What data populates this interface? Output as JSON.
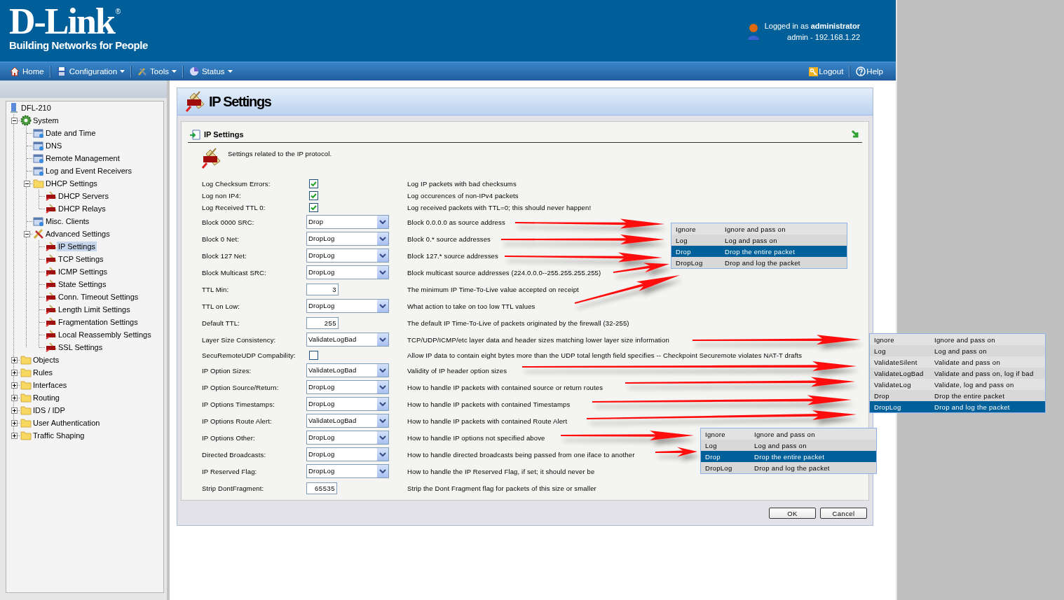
{
  "header": {
    "logo": "D-Link",
    "registered_mark": "®",
    "tagline": "Building Networks for People",
    "login_text": "Logged in as **administrator**",
    "session": "admin - 192.168.1.22"
  },
  "nav": {
    "items": [
      {
        "label": "Home",
        "has_menu": false
      },
      {
        "label": "Configuration",
        "has_menu": true
      },
      {
        "label": "Tools",
        "has_menu": true
      },
      {
        "label": "Status",
        "has_menu": true
      }
    ],
    "right_items": [
      {
        "label": "Logout"
      },
      {
        "label": "Help"
      }
    ]
  },
  "sidebar": {
    "tree": [
      {
        "label": "DFL-210",
        "selected": false,
        "children": [
          {
            "label": "System",
            "selected": false,
            "expanded": true,
            "children": [
              {
                "label": "Date and Time",
                "selected": false
              },
              {
                "label": "DNS",
                "selected": false
              },
              {
                "label": "Remote Management",
                "selected": false
              },
              {
                "label": "Log and Event Receivers",
                "selected": false
              },
              {
                "label": "DHCP Settings",
                "selected": false,
                "expanded": true,
                "children": [
                  {
                    "label": "DHCP Servers",
                    "selected": false
                  },
                  {
                    "label": "DHCP Relays",
                    "selected": false
                  }
                ]
              },
              {
                "label": "Misc. Clients",
                "selected": false
              },
              {
                "label": "Advanced Settings",
                "selected": false,
                "expanded": true,
                "children": [
                  {
                    "label": "IP Settings",
                    "selected": true
                  },
                  {
                    "label": "TCP Settings",
                    "selected": false
                  },
                  {
                    "label": "ICMP Settings",
                    "selected": false
                  },
                  {
                    "label": "State Settings",
                    "selected": false
                  },
                  {
                    "label": "Conn. Timeout Settings",
                    "selected": false
                  },
                  {
                    "label": "Length Limit Settings",
                    "selected": false
                  },
                  {
                    "label": "Fragmentation Settings",
                    "selected": false
                  },
                  {
                    "label": "Local Reassembly Settings",
                    "selected": false
                  },
                  {
                    "label": "SSL Settings",
                    "selected": false
                  }
                ]
              }
            ]
          },
          {
            "label": "Objects",
            "selected": false,
            "expanded": false
          },
          {
            "label": "Rules",
            "selected": false,
            "expanded": false
          },
          {
            "label": "Interfaces",
            "selected": false,
            "expanded": false
          },
          {
            "label": "Routing",
            "selected": false,
            "expanded": false
          },
          {
            "label": "IDS / IDP",
            "selected": false,
            "expanded": false
          },
          {
            "label": "User Authentication",
            "selected": false,
            "expanded": false
          },
          {
            "label": "Traffic Shaping",
            "selected": false,
            "expanded": false
          }
        ]
      }
    ]
  },
  "panel": {
    "title": "IP Settings",
    "section_title": "IP Settings",
    "intro": "Settings related to the IP protocol.",
    "settings": [
      {
        "label": "Log Checksum Errors:",
        "kind": "checkbox",
        "checked": true,
        "description": "Log IP packets with bad checksums"
      },
      {
        "label": "Log non IP4:",
        "kind": "checkbox",
        "checked": true,
        "description": "Log occurences of non-IPv4 packets"
      },
      {
        "label": "Log Received TTL 0:",
        "kind": "checkbox",
        "checked": true,
        "description": "Log received packets with TTL=0; this should never happen!"
      },
      {
        "label": "Block 0000 SRC:",
        "kind": "select",
        "value": "Drop",
        "description": "Block 0.0.0.0 as source address"
      },
      {
        "label": "Block 0 Net:",
        "kind": "select",
        "value": "DropLog",
        "description": "Block 0.* source addresses"
      },
      {
        "label": "Block 127 Net:",
        "kind": "select",
        "value": "DropLog",
        "description": "Block 127.* source addresses"
      },
      {
        "label": "Block Multicast SRC:",
        "kind": "select",
        "value": "DropLog",
        "description": "Block multicast source addresses (224.0.0.0--255.255.255.255)"
      },
      {
        "label": "TTL Min:",
        "kind": "number",
        "value": "3",
        "description": "The minimum IP Time-To-Live value accepted on receipt"
      },
      {
        "label": "TTL on Low:",
        "kind": "select",
        "value": "DropLog",
        "description": "What action to take on too low TTL values"
      },
      {
        "label": "Default TTL:",
        "kind": "number",
        "value": "255",
        "description": "The default IP Time-To-Live of packets originated by the firewall (32-255)"
      },
      {
        "label": "Layer Size Consistency:",
        "kind": "select",
        "value": "ValidateLogBad",
        "description": "TCP/UDP/ICMP/etc layer data and header sizes matching lower layer size information"
      },
      {
        "label": "SecuRemoteUDP Compability:",
        "kind": "checkbox",
        "checked": false,
        "description": "Allow IP data to contain eight bytes more than the UDP total length field specifies -- Checkpoint Securemote violates NAT-T drafts"
      },
      {
        "label": "IP Option Sizes:",
        "kind": "select",
        "value": "ValidateLogBad",
        "description": "Validity of IP header option sizes"
      },
      {
        "label": "IP Option Source/Return:",
        "kind": "select",
        "value": "DropLog",
        "description": "How to handle IP packets with contained source or return routes"
      },
      {
        "label": "IP Options Timestamps:",
        "kind": "select",
        "value": "DropLog",
        "description": "How to handle IP packets with contained Timestamps"
      },
      {
        "label": "IP Options Route Alert:",
        "kind": "select",
        "value": "ValidateLogBad",
        "description": "How to handle IP packets with contained Route Alert"
      },
      {
        "label": "IP Options Other:",
        "kind": "select",
        "value": "DropLog",
        "description": "How to handle IP options not specified above"
      },
      {
        "label": "Directed Broadcasts:",
        "kind": "select",
        "value": "DropLog",
        "description": "How to handle directed broadcasts being passed from one iface to another"
      },
      {
        "label": "IP Reserved Flag:",
        "kind": "select",
        "value": "DropLog",
        "description": "How to handle the IP Reserved Flag, if set; it should never be"
      },
      {
        "label": "Strip DontFragment:",
        "kind": "number",
        "value": "65535",
        "description": "Strip the Dont Fragment flag for packets of this size or smaller"
      }
    ],
    "buttons": [
      "OK",
      "Cancel"
    ]
  },
  "callouts": [
    {
      "options": [
        {
          "value": "Ignore",
          "description": "Ignore and pass on",
          "selected": false
        },
        {
          "value": "Log",
          "description": "Log and pass on",
          "selected": false
        },
        {
          "value": "Drop",
          "description": "Drop the entire packet",
          "selected": true
        },
        {
          "value": "DropLog",
          "description": "Drop and log the packet",
          "selected": false
        }
      ]
    },
    {
      "options": [
        {
          "value": "Ignore",
          "description": "Ignore and pass on",
          "selected": false
        },
        {
          "value": "Log",
          "description": "Log and pass on",
          "selected": false
        },
        {
          "value": "ValidateSilent",
          "description": "Validate and pass on",
          "selected": false
        },
        {
          "value": "ValidateLogBad",
          "description": "Validate and pass on, log if bad",
          "selected": false
        },
        {
          "value": "ValidateLog",
          "description": "Validate, log and pass on",
          "selected": false
        },
        {
          "value": "Drop",
          "description": "Drop the entire packet",
          "selected": false
        },
        {
          "value": "DropLog",
          "description": "Drop and log the packet",
          "selected": true
        }
      ]
    },
    {
      "options": [
        {
          "value": "Ignore",
          "description": "Ignore and pass on",
          "selected": false
        },
        {
          "value": "Log",
          "description": "Log and pass on",
          "selected": false
        },
        {
          "value": "Drop",
          "description": "Drop the entire packet",
          "selected": true
        },
        {
          "value": "DropLog",
          "description": "Drop and log the packet",
          "selected": false
        }
      ]
    }
  ]
}
